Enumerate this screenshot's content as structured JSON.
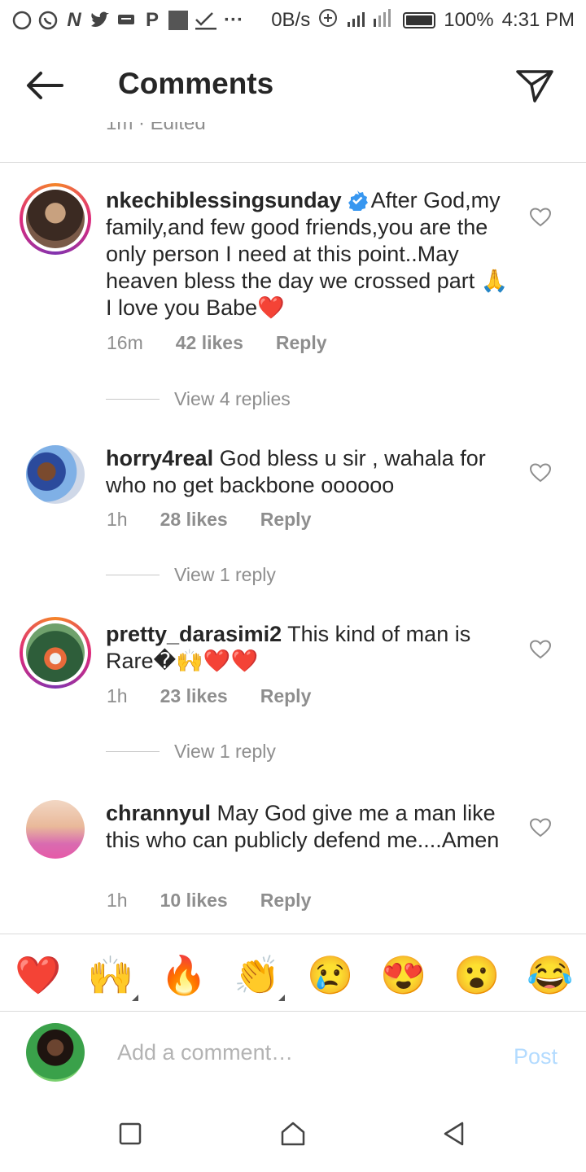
{
  "status_bar": {
    "left_icons": [
      "message-icon",
      "whatsapp-icon",
      "n-icon",
      "twitter-icon",
      "chat-icon",
      "p-icon",
      "gallery-icon",
      "check-icon",
      "more-icon"
    ],
    "network_speed": "0B/s",
    "battery": "100%",
    "time": "4:31 PM"
  },
  "header": {
    "title": "Comments"
  },
  "edited_strip": "1m · Edited",
  "comments": [
    {
      "username": "nkechiblessingsunday",
      "verified": true,
      "text": "After God,my family,and few good friends,you are the only person I need at this point..May heaven bless the day we crossed part 🙏 I love you Babe❤️",
      "time": "16m",
      "likes": "42 likes",
      "reply": "Reply",
      "view_replies": "View 4 replies"
    },
    {
      "username": "horry4real",
      "text": "God bless u sir , wahala for who no get backbone oooooo",
      "time": "1h",
      "likes": "28 likes",
      "reply": "Reply",
      "view_replies": "View 1 reply"
    },
    {
      "username": "pretty_darasimi2",
      "text": "This kind of man is Rare�🙌❤️❤️",
      "time": "1h",
      "likes": "23 likes",
      "reply": "Reply",
      "view_replies": "View 1 reply"
    },
    {
      "username": "chrannyul",
      "text": "May God give me a man like this who can publicly defend me....Amen",
      "time": "1h",
      "likes": "10 likes",
      "reply": "Reply"
    }
  ],
  "emoji_bar": [
    "❤️",
    "🙌",
    "🔥",
    "👏",
    "😢",
    "😍",
    "😮",
    "😂"
  ],
  "composer": {
    "placeholder": "Add a comment…",
    "post_label": "Post"
  },
  "colors": {
    "text": "#262626",
    "secondary": "#8e8e8e",
    "post_disabled": "#b3dbff",
    "verified": "#3897f0"
  }
}
